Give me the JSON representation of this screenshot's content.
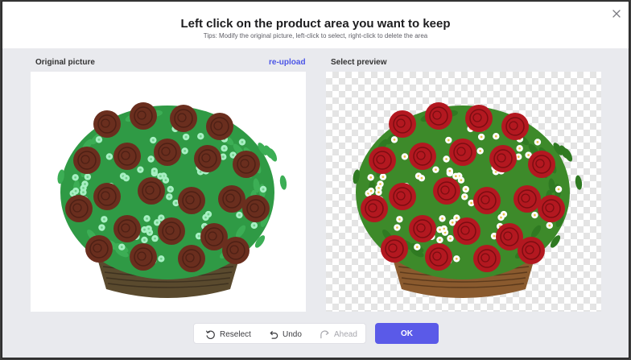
{
  "dialog": {
    "title": "Left click on the product area you want to keep",
    "tips": "Tips: Modify the original picture, left-click to select, right-click to delete the area"
  },
  "original": {
    "label": "Original picture",
    "reupload": "re-upload"
  },
  "preview": {
    "label": "Select preview"
  },
  "toolbar": {
    "reselect": "Reselect",
    "undo": "Undo",
    "ahead": "Ahead"
  },
  "actions": {
    "ok": "OK"
  },
  "icons": {
    "close": "close-icon",
    "reselect": "reselect-icon",
    "undo": "undo-icon",
    "ahead": "redo-icon"
  },
  "colors": {
    "accent": "#5a5ae8",
    "link": "#4b55e6",
    "selection_overlay": "#5cdc8c",
    "rose": "#b31820",
    "daisy": "#ffffff",
    "leaf": "#3d8a2a",
    "basket": "#8a5a2e"
  }
}
